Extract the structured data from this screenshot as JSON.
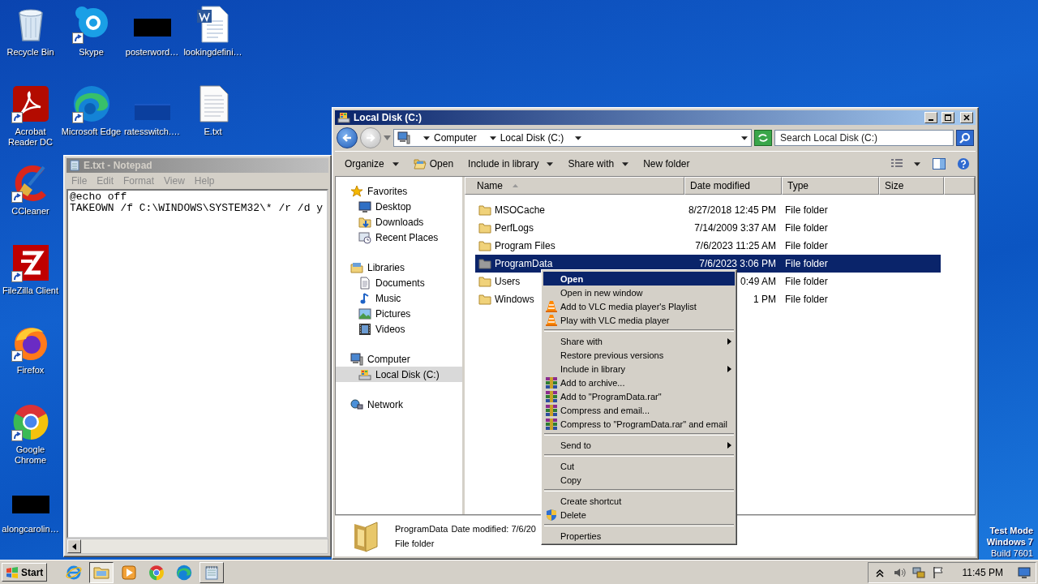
{
  "desktop": {
    "columns": [
      [
        {
          "label": "Recycle Bin",
          "kind": "recycle",
          "shortcut": false
        },
        {
          "label": "Acrobat\nReader DC",
          "kind": "acrobat",
          "shortcut": true
        },
        {
          "label": "CCleaner",
          "kind": "ccleaner",
          "shortcut": true
        },
        {
          "label": "FileZilla Client",
          "kind": "filezilla",
          "shortcut": true
        },
        {
          "label": "Firefox",
          "kind": "firefox",
          "shortcut": true
        },
        {
          "label": "Google\nChrome",
          "kind": "chrome",
          "shortcut": true
        },
        {
          "label": "alongcarolin…",
          "kind": "redacted",
          "shortcut": false
        }
      ],
      [
        {
          "label": "Skype",
          "kind": "skype",
          "shortcut": true
        },
        {
          "label": "Microsoft Edge",
          "kind": "edge",
          "shortcut": true
        }
      ],
      [
        {
          "label": "posterword…",
          "kind": "redacted",
          "shortcut": false
        },
        {
          "label": "ratesswitch.…",
          "kind": "blank",
          "shortcut": false
        }
      ],
      [
        {
          "label": "lookingdefini…",
          "kind": "word",
          "shortcut": false
        },
        {
          "label": "E.txt",
          "kind": "text",
          "shortcut": false
        }
      ]
    ],
    "notice": [
      "Test Mode",
      "Windows 7",
      "Build 7601"
    ]
  },
  "notepad": {
    "title": "E.txt - Notepad",
    "menu": [
      "File",
      "Edit",
      "Format",
      "View",
      "Help"
    ],
    "text": "@echo off\nTAKEOWN /f C:\\WINDOWS\\SYSTEM32\\* /r /d y"
  },
  "explorer": {
    "title": "Local Disk (C:)",
    "breadcrumb": [
      "Computer",
      "Local Disk (C:)"
    ],
    "search": {
      "placeholder": "Search Local Disk (C:)"
    },
    "toolbar": [
      {
        "label": "Organize",
        "kind": "dropdown"
      },
      {
        "label": "Open",
        "kind": "open"
      },
      {
        "label": "Include in library",
        "kind": "dropdown"
      },
      {
        "label": "Share with",
        "kind": "dropdown"
      },
      {
        "label": "New folder",
        "kind": "plain"
      }
    ],
    "navigation": [
      {
        "label": "Favorites",
        "kind": "star",
        "selected": false,
        "children": [
          {
            "label": "Desktop",
            "kind": "desktop",
            "selected": false
          },
          {
            "label": "Downloads",
            "kind": "downloads",
            "selected": false
          },
          {
            "label": "Recent Places",
            "kind": "recent",
            "selected": false
          }
        ]
      },
      {
        "label": "Libraries",
        "kind": "library",
        "selected": false,
        "children": [
          {
            "label": "Documents",
            "kind": "document",
            "selected": false
          },
          {
            "label": "Music",
            "kind": "music",
            "selected": false
          },
          {
            "label": "Pictures",
            "kind": "picture",
            "selected": false
          },
          {
            "label": "Videos",
            "kind": "video",
            "selected": false
          }
        ]
      },
      {
        "label": "Computer",
        "kind": "computer",
        "selected": false,
        "children": [
          {
            "label": "Local Disk (C:)",
            "kind": "disk",
            "selected": true
          }
        ]
      },
      {
        "label": "Network",
        "kind": "network",
        "selected": false
      }
    ],
    "columns": [
      "Name",
      "Date modified",
      "Type",
      "Size"
    ],
    "rows": [
      {
        "name": "MSOCache",
        "date": "8/27/2018 12:45 PM",
        "type": "File folder",
        "kind": "locked-folder",
        "selected": false
      },
      {
        "name": "PerfLogs",
        "date": "7/14/2009 3:37 AM",
        "type": "File folder",
        "kind": "folder",
        "selected": false
      },
      {
        "name": "Program Files",
        "date": "7/6/2023 11:25 AM",
        "type": "File folder",
        "kind": "folder",
        "selected": false
      },
      {
        "name": "ProgramData",
        "date": "7/6/2023 3:06 PM",
        "type": "File folder",
        "kind": "hidden-folder",
        "selected": true
      },
      {
        "name": "Users",
        "date": "0:49 AM",
        "type": "File folder",
        "kind": "folder",
        "selected": false
      },
      {
        "name": "Windows",
        "date": "1 PM",
        "type": "File folder",
        "kind": "folder",
        "selected": false
      }
    ],
    "details": {
      "name": "ProgramData",
      "modified": "Date modified: 7/6/20",
      "type": "File folder"
    }
  },
  "context_menu": {
    "items": [
      {
        "kind": "plain",
        "label": "Open",
        "default": true,
        "selected": true,
        "submenu": false
      },
      {
        "kind": "plain",
        "label": "Open in new window",
        "default": false,
        "selected": false,
        "submenu": false
      },
      {
        "kind": "vlc",
        "label": "Add to VLC media player's Playlist",
        "default": false,
        "selected": false,
        "submenu": false
      },
      {
        "kind": "vlc",
        "label": "Play with VLC media player",
        "default": false,
        "selected": false,
        "submenu": false
      },
      {
        "kind": "separator"
      },
      {
        "kind": "plain",
        "label": "Share with",
        "default": false,
        "selected": false,
        "submenu": true
      },
      {
        "kind": "plain",
        "label": "Restore previous versions",
        "default": false,
        "selected": false,
        "submenu": false
      },
      {
        "kind": "plain",
        "label": "Include in library",
        "default": false,
        "selected": false,
        "submenu": true
      },
      {
        "kind": "archive",
        "label": "Add to archive...",
        "default": false,
        "selected": false,
        "submenu": false
      },
      {
        "kind": "archive",
        "label": "Add to \"ProgramData.rar\"",
        "default": false,
        "selected": false,
        "submenu": false
      },
      {
        "kind": "archive",
        "label": "Compress and email...",
        "default": false,
        "selected": false,
        "submenu": false
      },
      {
        "kind": "archive",
        "label": "Compress to \"ProgramData.rar\" and email",
        "default": false,
        "selected": false,
        "submenu": false
      },
      {
        "kind": "separator"
      },
      {
        "kind": "plain",
        "label": "Send to",
        "default": false,
        "selected": false,
        "submenu": true
      },
      {
        "kind": "separator"
      },
      {
        "kind": "plain",
        "label": "Cut",
        "default": false,
        "selected": false,
        "submenu": false
      },
      {
        "kind": "plain",
        "label": "Copy",
        "default": false,
        "selected": false,
        "submenu": false
      },
      {
        "kind": "separator"
      },
      {
        "kind": "plain",
        "label": "Create shortcut",
        "default": false,
        "selected": false,
        "submenu": false
      },
      {
        "kind": "shield",
        "label": "Delete",
        "default": false,
        "selected": false,
        "submenu": false
      },
      {
        "kind": "separator"
      },
      {
        "kind": "plain",
        "label": "Properties",
        "default": false,
        "selected": false,
        "submenu": false
      }
    ]
  },
  "taskbar": {
    "start": "Start",
    "apps": [
      {
        "kind": "ie",
        "selected": false,
        "running": false
      },
      {
        "kind": "explorer",
        "selected": true,
        "running": true
      },
      {
        "kind": "media",
        "selected": false,
        "running": false
      },
      {
        "kind": "chrome",
        "selected": false,
        "running": false
      },
      {
        "kind": "edge",
        "selected": false,
        "running": false
      },
      {
        "kind": "notepad",
        "selected": false,
        "running": true
      }
    ],
    "clock": "11:45 PM"
  }
}
